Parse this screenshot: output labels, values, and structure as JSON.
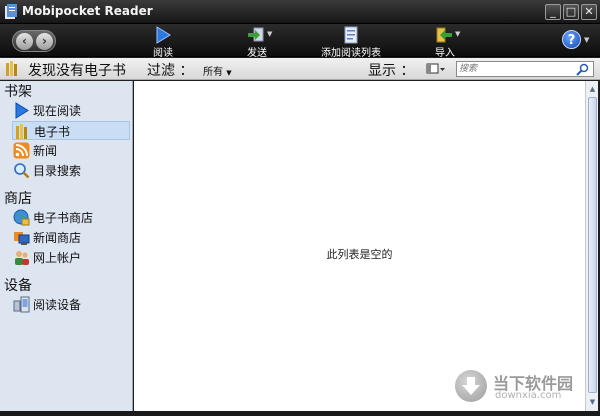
{
  "window": {
    "title": "Mobipocket Reader",
    "controls": {
      "minimize": "_",
      "maximize": "□",
      "close": "✕"
    }
  },
  "toolbar": {
    "back_icon": "back-arrow-icon",
    "forward_icon": "forward-arrow-icon",
    "read_label": "阅读",
    "send_label": "发送",
    "add_to_reading_list_label": "添加阅读列表",
    "import_label": "导入",
    "help_label": "?"
  },
  "filterbar": {
    "title": "发现没有电子书",
    "filter_label": "过滤 ：",
    "filter_value": "所有",
    "display_label": "显示 ：",
    "search_placeholder": "搜索"
  },
  "sidebar": {
    "sections": [
      {
        "title": "书架",
        "items": [
          {
            "label": "现在阅读",
            "icon": "play-icon",
            "selected": false
          },
          {
            "label": "电子书",
            "icon": "books-icon",
            "selected": true
          },
          {
            "label": "新闻",
            "icon": "rss-icon",
            "selected": false
          },
          {
            "label": "目录搜索",
            "icon": "magnifier-icon",
            "selected": false
          }
        ]
      },
      {
        "title": "商店",
        "items": [
          {
            "label": "电子书商店",
            "icon": "globe-store-icon"
          },
          {
            "label": "新闻商店",
            "icon": "news-store-icon"
          },
          {
            "label": "网上帐户",
            "icon": "account-icon"
          }
        ]
      },
      {
        "title": "设备",
        "items": [
          {
            "label": "阅读设备",
            "icon": "device-icon"
          }
        ]
      }
    ]
  },
  "main": {
    "empty_message": "此列表是空的"
  },
  "watermark": {
    "line1": "当下软件园",
    "line2": "downxia.com"
  },
  "colors": {
    "sidebar_bg": "#dde5f1",
    "selected_bg": "#c9ddf5",
    "toolbar_bg": "#161616",
    "accent": "#1f6fd0"
  }
}
